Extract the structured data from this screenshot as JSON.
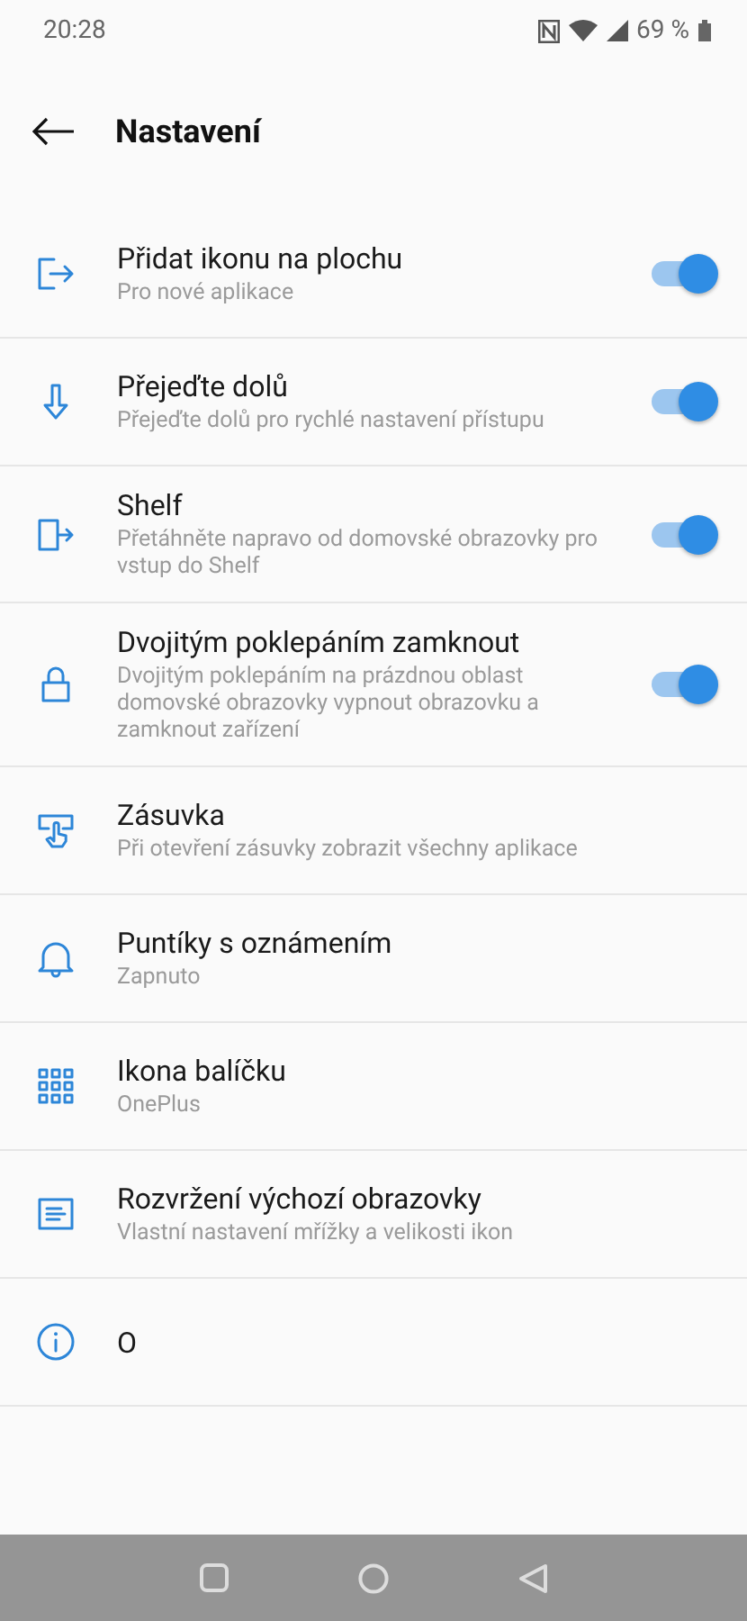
{
  "status_bar": {
    "time": "20:28",
    "battery": "69 %"
  },
  "header": {
    "title": "Nastavení"
  },
  "items": [
    {
      "title": "Přidat ikonu na plochu",
      "subtitle": "Pro nové aplikace",
      "on": true
    },
    {
      "title": "Přejeďte dolů",
      "subtitle": "Přejeďte dolů pro rychlé nastavení přístupu",
      "on": true
    },
    {
      "title": "Shelf",
      "subtitle": "Přetáhněte napravo od domovské obrazovky pro vstup do Shelf",
      "on": true
    },
    {
      "title": "Dvojitým poklepáním zamknout",
      "subtitle": "Dvojitým poklepáním na prázdnou oblast domovské obrazovky vypnout obrazovku a zamknout zařízení",
      "on": true
    },
    {
      "title": "Zásuvka",
      "subtitle": "Při otevření zásuvky zobrazit všechny aplikace"
    },
    {
      "title": "Puntíky s oznámením",
      "subtitle": "Zapnuto"
    },
    {
      "title": "Ikona balíčku",
      "subtitle": "OnePlus"
    },
    {
      "title": "Rozvržení výchozí obrazovky",
      "subtitle": "Vlastní nastavení mřížky a velikosti ikon"
    },
    {
      "title": "O"
    }
  ]
}
